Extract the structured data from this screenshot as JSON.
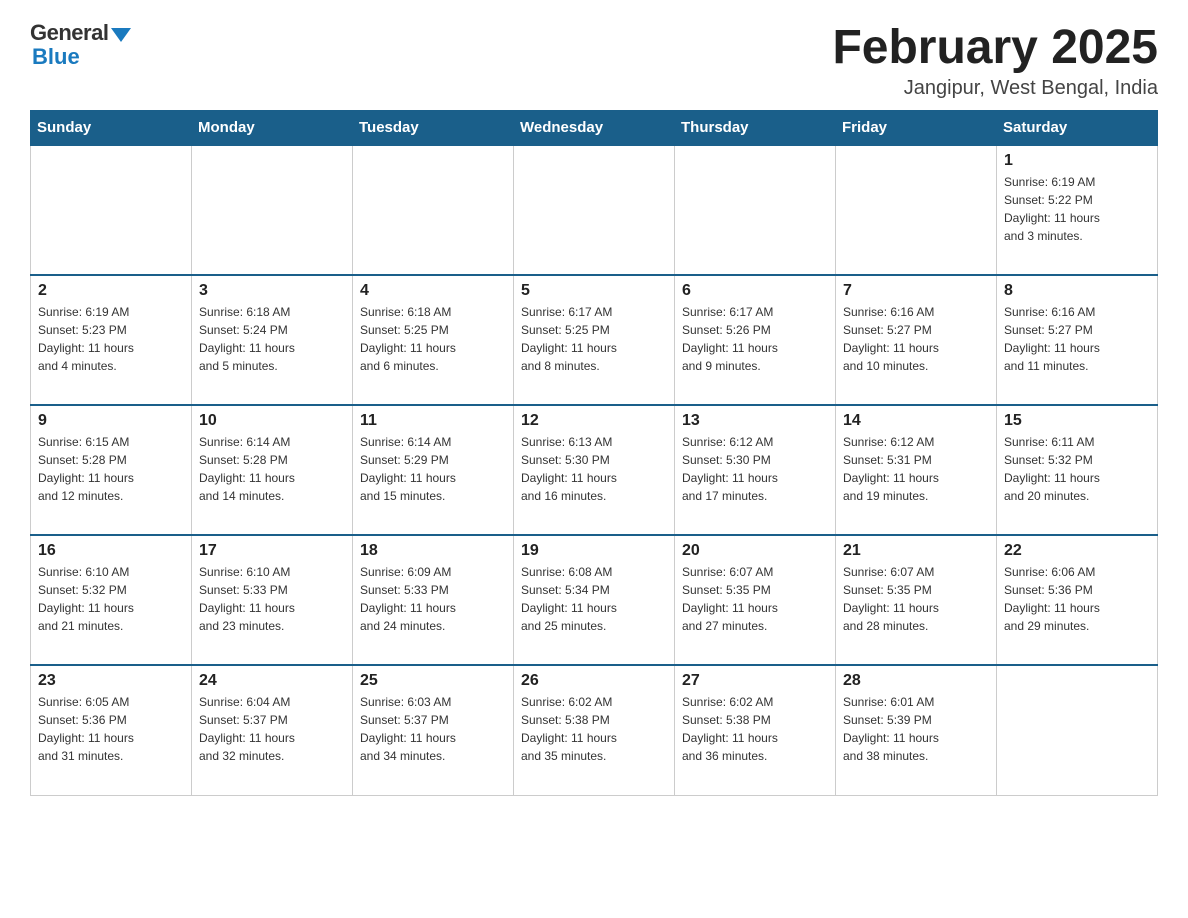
{
  "header": {
    "logo": {
      "general": "General",
      "blue": "Blue"
    },
    "title": "February 2025",
    "location": "Jangipur, West Bengal, India"
  },
  "weekdays": [
    "Sunday",
    "Monday",
    "Tuesday",
    "Wednesday",
    "Thursday",
    "Friday",
    "Saturday"
  ],
  "weeks": [
    [
      {
        "day": "",
        "info": ""
      },
      {
        "day": "",
        "info": ""
      },
      {
        "day": "",
        "info": ""
      },
      {
        "day": "",
        "info": ""
      },
      {
        "day": "",
        "info": ""
      },
      {
        "day": "",
        "info": ""
      },
      {
        "day": "1",
        "info": "Sunrise: 6:19 AM\nSunset: 5:22 PM\nDaylight: 11 hours\nand 3 minutes."
      }
    ],
    [
      {
        "day": "2",
        "info": "Sunrise: 6:19 AM\nSunset: 5:23 PM\nDaylight: 11 hours\nand 4 minutes."
      },
      {
        "day": "3",
        "info": "Sunrise: 6:18 AM\nSunset: 5:24 PM\nDaylight: 11 hours\nand 5 minutes."
      },
      {
        "day": "4",
        "info": "Sunrise: 6:18 AM\nSunset: 5:25 PM\nDaylight: 11 hours\nand 6 minutes."
      },
      {
        "day": "5",
        "info": "Sunrise: 6:17 AM\nSunset: 5:25 PM\nDaylight: 11 hours\nand 8 minutes."
      },
      {
        "day": "6",
        "info": "Sunrise: 6:17 AM\nSunset: 5:26 PM\nDaylight: 11 hours\nand 9 minutes."
      },
      {
        "day": "7",
        "info": "Sunrise: 6:16 AM\nSunset: 5:27 PM\nDaylight: 11 hours\nand 10 minutes."
      },
      {
        "day": "8",
        "info": "Sunrise: 6:16 AM\nSunset: 5:27 PM\nDaylight: 11 hours\nand 11 minutes."
      }
    ],
    [
      {
        "day": "9",
        "info": "Sunrise: 6:15 AM\nSunset: 5:28 PM\nDaylight: 11 hours\nand 12 minutes."
      },
      {
        "day": "10",
        "info": "Sunrise: 6:14 AM\nSunset: 5:28 PM\nDaylight: 11 hours\nand 14 minutes."
      },
      {
        "day": "11",
        "info": "Sunrise: 6:14 AM\nSunset: 5:29 PM\nDaylight: 11 hours\nand 15 minutes."
      },
      {
        "day": "12",
        "info": "Sunrise: 6:13 AM\nSunset: 5:30 PM\nDaylight: 11 hours\nand 16 minutes."
      },
      {
        "day": "13",
        "info": "Sunrise: 6:12 AM\nSunset: 5:30 PM\nDaylight: 11 hours\nand 17 minutes."
      },
      {
        "day": "14",
        "info": "Sunrise: 6:12 AM\nSunset: 5:31 PM\nDaylight: 11 hours\nand 19 minutes."
      },
      {
        "day": "15",
        "info": "Sunrise: 6:11 AM\nSunset: 5:32 PM\nDaylight: 11 hours\nand 20 minutes."
      }
    ],
    [
      {
        "day": "16",
        "info": "Sunrise: 6:10 AM\nSunset: 5:32 PM\nDaylight: 11 hours\nand 21 minutes."
      },
      {
        "day": "17",
        "info": "Sunrise: 6:10 AM\nSunset: 5:33 PM\nDaylight: 11 hours\nand 23 minutes."
      },
      {
        "day": "18",
        "info": "Sunrise: 6:09 AM\nSunset: 5:33 PM\nDaylight: 11 hours\nand 24 minutes."
      },
      {
        "day": "19",
        "info": "Sunrise: 6:08 AM\nSunset: 5:34 PM\nDaylight: 11 hours\nand 25 minutes."
      },
      {
        "day": "20",
        "info": "Sunrise: 6:07 AM\nSunset: 5:35 PM\nDaylight: 11 hours\nand 27 minutes."
      },
      {
        "day": "21",
        "info": "Sunrise: 6:07 AM\nSunset: 5:35 PM\nDaylight: 11 hours\nand 28 minutes."
      },
      {
        "day": "22",
        "info": "Sunrise: 6:06 AM\nSunset: 5:36 PM\nDaylight: 11 hours\nand 29 minutes."
      }
    ],
    [
      {
        "day": "23",
        "info": "Sunrise: 6:05 AM\nSunset: 5:36 PM\nDaylight: 11 hours\nand 31 minutes."
      },
      {
        "day": "24",
        "info": "Sunrise: 6:04 AM\nSunset: 5:37 PM\nDaylight: 11 hours\nand 32 minutes."
      },
      {
        "day": "25",
        "info": "Sunrise: 6:03 AM\nSunset: 5:37 PM\nDaylight: 11 hours\nand 34 minutes."
      },
      {
        "day": "26",
        "info": "Sunrise: 6:02 AM\nSunset: 5:38 PM\nDaylight: 11 hours\nand 35 minutes."
      },
      {
        "day": "27",
        "info": "Sunrise: 6:02 AM\nSunset: 5:38 PM\nDaylight: 11 hours\nand 36 minutes."
      },
      {
        "day": "28",
        "info": "Sunrise: 6:01 AM\nSunset: 5:39 PM\nDaylight: 11 hours\nand 38 minutes."
      },
      {
        "day": "",
        "info": ""
      }
    ]
  ]
}
